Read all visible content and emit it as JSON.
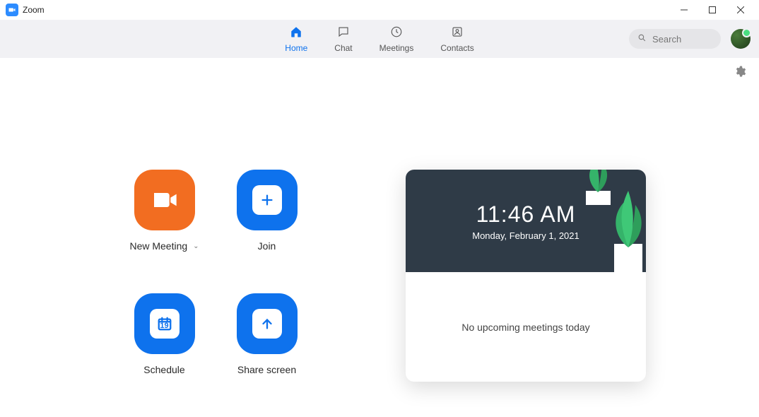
{
  "window": {
    "title": "Zoom"
  },
  "tabs": {
    "home": "Home",
    "chat": "Chat",
    "meetings": "Meetings",
    "contacts": "Contacts",
    "active": "home"
  },
  "search": {
    "placeholder": "Search"
  },
  "actions": {
    "new_meeting": "New Meeting",
    "join": "Join",
    "schedule": "Schedule",
    "schedule_day": "19",
    "share_screen": "Share screen"
  },
  "calendar": {
    "time": "11:46 AM",
    "date": "Monday, February 1, 2021",
    "empty_msg": "No upcoming meetings today"
  }
}
